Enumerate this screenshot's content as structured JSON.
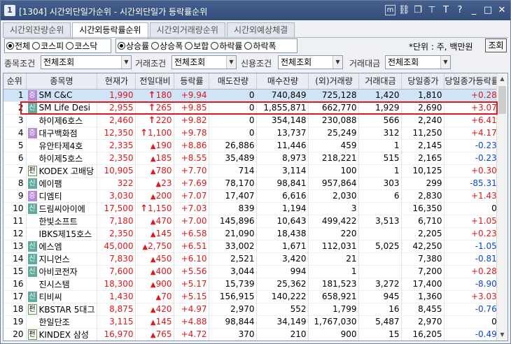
{
  "window": {
    "number": "1",
    "title": "[1304] 시간외단일가순위 - 시간외단일가 등락률순위",
    "icons": [
      "m-icon",
      "link-icon",
      "copy-icon",
      "pin-icon",
      "T-icon",
      "help-icon",
      "minimize-icon",
      "maximize-icon",
      "close-icon"
    ],
    "icon_glyphs": [
      "m",
      "⛓",
      "❐",
      "⊤",
      "T",
      "?",
      "_",
      "□",
      "✕"
    ]
  },
  "tabs": [
    "시간외잔량순위",
    "시간외등락률순위",
    "시간외거래량순위",
    "시간외예상체결"
  ],
  "active_tab": 1,
  "market_radios": [
    "전체",
    "코스피",
    "코스닥"
  ],
  "market_selected": 0,
  "direction_radios": [
    "상승률",
    "상승폭",
    "보합",
    "하락률",
    "하락폭"
  ],
  "direction_selected": 0,
  "unit_text": "*단위 : 주, 백만원",
  "search_button": "조회",
  "conditions": {
    "stock_label": "종목조건",
    "stock_value": "전체조회",
    "trade_label": "거래조건",
    "trade_value": "전체조회",
    "credit_label": "신용조건",
    "credit_value": "전체조회",
    "amount_label": "거래대금",
    "amount_value": "전체조회"
  },
  "columns": [
    "순위",
    "종목명",
    "현재가",
    "전일대비",
    "등락률",
    "매도잔량",
    "매수잔량",
    "(외)거래량",
    "거래대금",
    "당일종가",
    "당일종가등락률"
  ],
  "colors": {
    "up": "#e0171b",
    "down": "#0a46d6",
    "highlight": "#e2161d",
    "title_bg": "#3a5280"
  },
  "rows": [
    {
      "rank": "1",
      "badge": "증",
      "name": "SM C&C",
      "price": "1,990",
      "dir": "up-big",
      "change": "180",
      "rate": "+9.94",
      "sell": "0",
      "buy": "740,849",
      "vol": "725,128",
      "amount": "1,420",
      "close": "1,810",
      "close_rate": "+0.28",
      "price_color": "up",
      "close_color": "up"
    },
    {
      "rank": "2",
      "badge": "신",
      "name": "SM Life Desi",
      "price": "2,955",
      "dir": "up-big",
      "change": "265",
      "rate": "+9.85",
      "sell": "0",
      "buy": "1,855,871",
      "vol": "662,770",
      "amount": "1,929",
      "close": "2,690",
      "close_rate": "+3.07",
      "price_color": "up",
      "close_color": "up"
    },
    {
      "rank": "3",
      "badge": "",
      "name": "하이제6호스",
      "price": "2,460",
      "dir": "up-big",
      "change": "220",
      "rate": "+9.82",
      "sell": "0",
      "buy": "354,148",
      "vol": "230,088",
      "amount": "566",
      "close": "2,240",
      "close_rate": "+6.41",
      "price_color": "up",
      "close_color": "up"
    },
    {
      "rank": "4",
      "badge": "증",
      "name": "대구백화점",
      "price": "12,350",
      "dir": "up-big",
      "change": "1,100",
      "rate": "+9.78",
      "sell": "0",
      "buy": "13,737",
      "vol": "25,249",
      "amount": "312",
      "close": "11,250",
      "close_rate": "+4.17",
      "price_color": "up",
      "close_color": "up"
    },
    {
      "rank": "5",
      "badge": "",
      "name": "유안타제4호",
      "price": "2,335",
      "dir": "up",
      "change": "190",
      "rate": "+8.86",
      "sell": "26,886",
      "buy": "11,446",
      "vol": "459",
      "amount": "1",
      "close": "2,145",
      "close_rate": "-0.23",
      "price_color": "up",
      "close_color": "down"
    },
    {
      "rank": "6",
      "badge": "",
      "name": "하이제5호스",
      "price": "2,350",
      "dir": "up",
      "change": "185",
      "rate": "+8.55",
      "sell": "35,489",
      "buy": "8,973",
      "vol": "218,221",
      "amount": "515",
      "close": "2,165",
      "close_rate": "-0.23",
      "price_color": "up",
      "close_color": "down"
    },
    {
      "rank": "7",
      "badge": "펀",
      "name": "KODEX 고배당",
      "price": "10,905",
      "dir": "up",
      "change": "780",
      "rate": "+7.70",
      "sell": "714",
      "buy": "3,114",
      "vol": "100",
      "amount": "1",
      "close": "10,125",
      "close_rate": "+0.30",
      "price_color": "up",
      "close_color": "up"
    },
    {
      "rank": "8",
      "badge": "신",
      "name": "에이팸",
      "price": "322",
      "dir": "up",
      "change": "23",
      "rate": "+7.69",
      "sell": "78,170",
      "buy": "98,841",
      "vol": "957,864",
      "amount": "303",
      "close": "299",
      "close_rate": "-85.31",
      "price_color": "up",
      "close_color": "down"
    },
    {
      "rank": "9",
      "badge": "증",
      "name": "디엠티",
      "price": "3,030",
      "dir": "up",
      "change": "200",
      "rate": "+7.07",
      "sell": "17,407",
      "buy": "6,616",
      "vol": "2,030",
      "amount": "6",
      "close": "2,830",
      "close_rate": "+1.43",
      "price_color": "up",
      "close_color": "up"
    },
    {
      "rank": "10",
      "badge": "신",
      "name": "드림씨아이에",
      "price": "17,500",
      "dir": "up-big",
      "change": "1,150",
      "rate": "+7.03",
      "sell": "839",
      "buy": "1,194",
      "vol": "3",
      "amount": "",
      "close": "16,350",
      "close_rate": "0",
      "price_color": "up",
      "close_color": "zero"
    },
    {
      "rank": "11",
      "badge": "",
      "name": "한빛소프트",
      "price": "7,180",
      "dir": "up",
      "change": "470",
      "rate": "+7.00",
      "sell": "145,896",
      "buy": "10,643",
      "vol": "499,422",
      "amount": "3,513",
      "close": "6,710",
      "close_rate": "+1.05",
      "price_color": "up",
      "close_color": "up"
    },
    {
      "rank": "12",
      "badge": "",
      "name": "IBKS제15호스",
      "price": "2,350",
      "dir": "up",
      "change": "145",
      "rate": "+6.58",
      "sell": "21,090",
      "buy": "18,438",
      "vol": "220",
      "amount": "",
      "close": "2,205",
      "close_rate": "+0.23",
      "price_color": "up",
      "close_color": "up"
    },
    {
      "rank": "13",
      "badge": "신",
      "name": "에스엠",
      "price": "45,000",
      "dir": "up",
      "change": "2,750",
      "rate": "+6.51",
      "sell": "33,002",
      "buy": "1,671",
      "vol": "112,031",
      "amount": "5,025",
      "close": "42,250",
      "close_rate": "-1.05",
      "price_color": "up",
      "close_color": "down"
    },
    {
      "rank": "14",
      "badge": "신",
      "name": "지니언스",
      "price": "7,830",
      "dir": "up",
      "change": "450",
      "rate": "+6.10",
      "sell": "2,521",
      "buy": "3,420",
      "vol": "21",
      "amount": "",
      "close": "7,380",
      "close_rate": "-0.81",
      "price_color": "up",
      "close_color": "down"
    },
    {
      "rank": "15",
      "badge": "신",
      "name": "아비코전자",
      "price": "7,600",
      "dir": "up",
      "change": "400",
      "rate": "+5.56",
      "sell": "3,044",
      "buy": "994",
      "vol": "1",
      "amount": "",
      "close": "7,200",
      "close_rate": "+0.28",
      "price_color": "up",
      "close_color": "up"
    },
    {
      "rank": "16",
      "badge": "",
      "name": "진시스템",
      "price": "18,300",
      "dir": "up",
      "change": "900",
      "rate": "+5.17",
      "sell": "15,739",
      "buy": "25,362",
      "vol": "181,523",
      "amount": "3,272",
      "close": "17,400",
      "close_rate": "-8.90",
      "price_color": "up",
      "close_color": "down"
    },
    {
      "rank": "17",
      "badge": "신",
      "name": "티비씨",
      "price": "1,430",
      "dir": "up",
      "change": "70",
      "rate": "+5.15",
      "sell": "156,915",
      "buy": "140,222",
      "vol": "658,921",
      "amount": "945",
      "close": "1,360",
      "close_rate": "+3.03",
      "price_color": "up",
      "close_color": "up"
    },
    {
      "rank": "18",
      "badge": "펀",
      "name": "KBSTAR 5대그",
      "price": "8,875",
      "dir": "up",
      "change": "420",
      "rate": "+4.97",
      "sell": "2,970",
      "buy": "552",
      "vol": "1,799",
      "amount": "16",
      "close": "8,455",
      "close_rate": "-0.76",
      "price_color": "up",
      "close_color": "down"
    },
    {
      "rank": "19",
      "badge": "",
      "name": "한일단조",
      "price": "3,115",
      "dir": "up",
      "change": "145",
      "rate": "+4.88",
      "sell": "98,844",
      "buy": "34,149",
      "vol": "1,767,030",
      "amount": "5,487",
      "close": "2,970",
      "close_rate": "0",
      "price_color": "up",
      "close_color": "zero"
    },
    {
      "rank": "20",
      "badge": "펀",
      "name": "KINDEX 삼성",
      "price": "16,970",
      "dir": "up",
      "change": "765",
      "rate": "+4.72",
      "sell": "370",
      "buy": "210",
      "vol": "900",
      "amount": "15",
      "close": "16,205",
      "close_rate": "-0.49",
      "price_color": "up",
      "close_color": "down"
    }
  ],
  "selected_row": 0,
  "highlighted_row": 1
}
